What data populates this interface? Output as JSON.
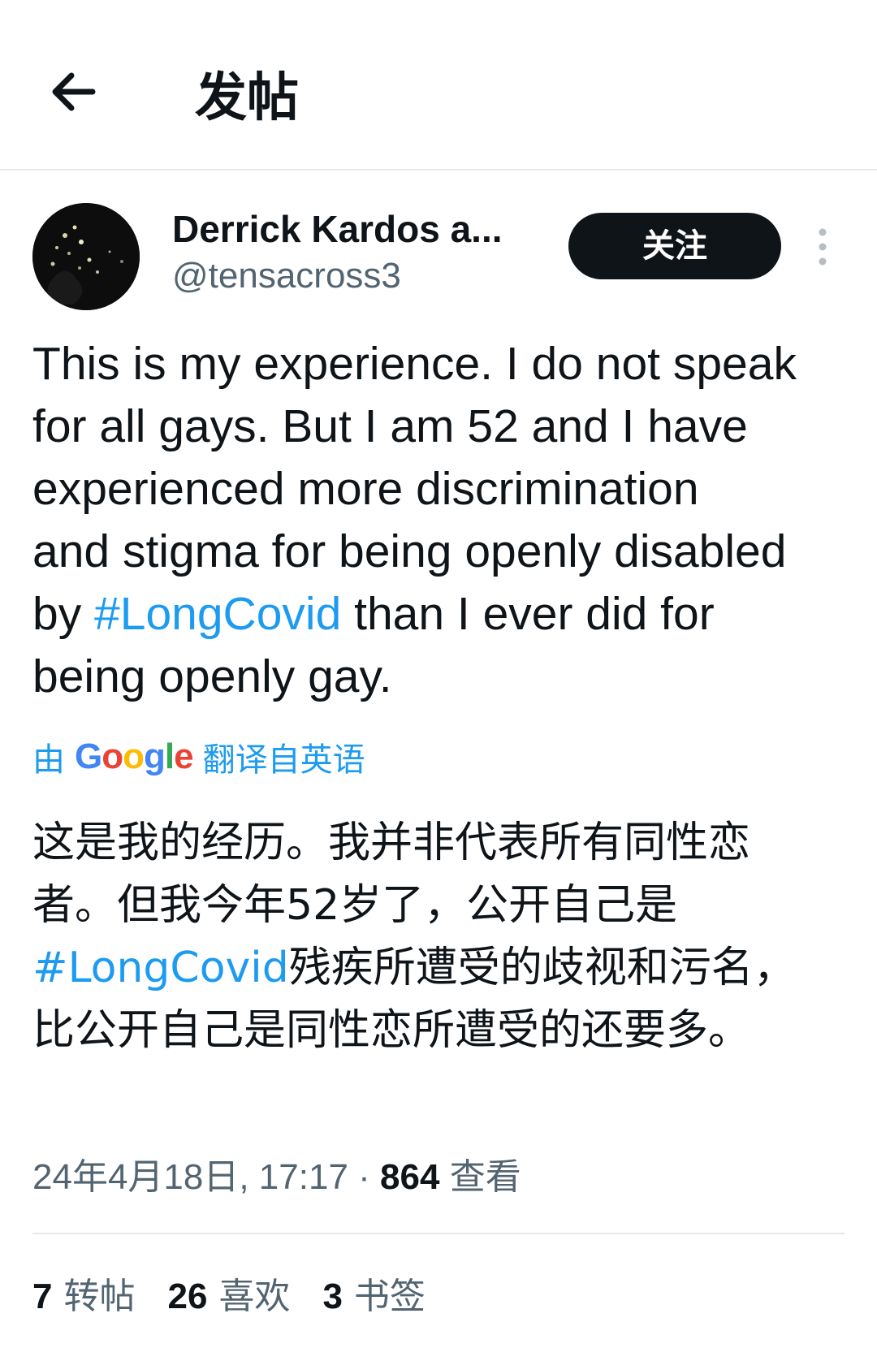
{
  "header": {
    "title": "发帖"
  },
  "author": {
    "name": "Derrick Kardos a...",
    "handle": "@tensacross3",
    "follow_label": "关注"
  },
  "tweet": {
    "text_before": "This is my experience. I do not speak\nfor all gays. But I am 52 and I have\nexperienced more discrimination\nand stigma for being openly disabled\nby ",
    "hashtag": "#LongCovid",
    "text_after": " than I ever did for\nbeing openly gay."
  },
  "translation": {
    "prefix": "由",
    "provider": "Google",
    "suffix": "翻译自英语",
    "text_before": "这是我的经历。我并非代表所有同性恋者。但我今年52岁了，公开自己是",
    "hashtag": "#LongCovid",
    "text_after": "残疾所遭受的歧视和污名，比公开自己是同性恋所遭受的还要多。"
  },
  "meta": {
    "timestamp": "24年4月18日, 17:17",
    "separator": "·",
    "views_count": "864",
    "views_label": "查看"
  },
  "stats": {
    "reposts_count": "7",
    "reposts_label": "转帖",
    "likes_count": "26",
    "likes_label": "喜欢",
    "bookmarks_count": "3",
    "bookmarks_label": "书签"
  },
  "colors": {
    "accent": "#1d9bf0",
    "text": "#0f1419",
    "muted": "#536471",
    "follow_bg": "#0f1419"
  },
  "icons": {
    "back": "arrow-left-icon",
    "more": "more-vertical-icon"
  }
}
